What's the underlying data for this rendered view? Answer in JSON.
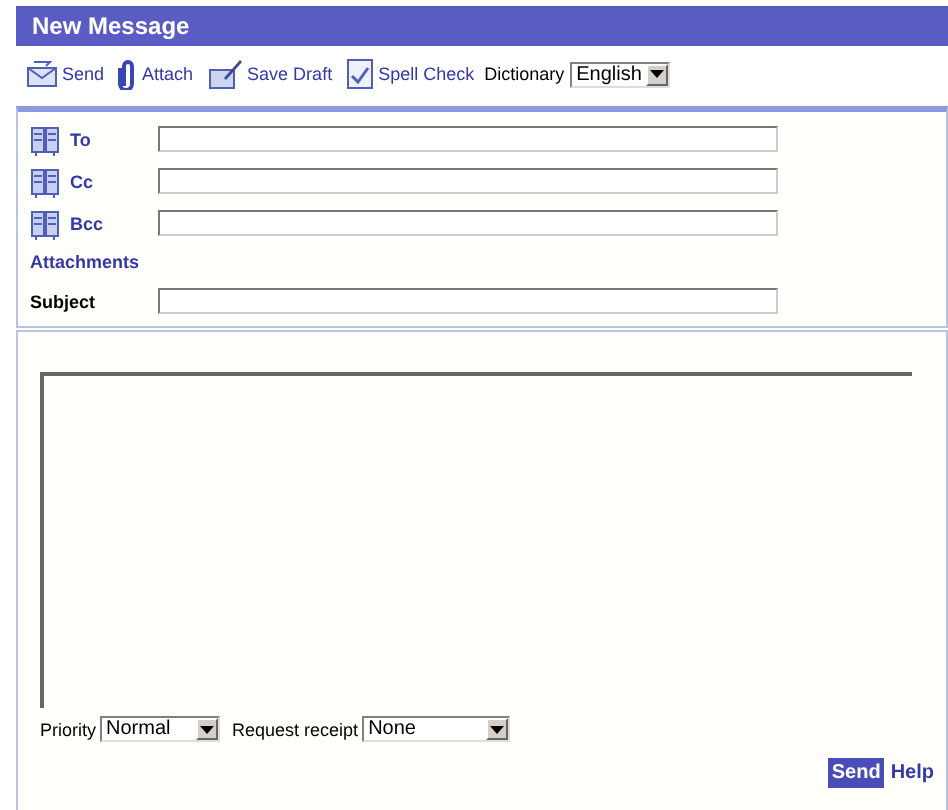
{
  "window": {
    "title": "New Message"
  },
  "toolbar": [
    {
      "kind": "send",
      "label": "Send"
    },
    {
      "kind": "attach",
      "label": "Attach"
    },
    {
      "kind": "draft",
      "label": "Save Draft"
    },
    {
      "kind": "spell",
      "label": "Spell Check"
    }
  ],
  "dictionary": {
    "label": "Dictionary",
    "value": "English"
  },
  "header_rows": [
    {
      "kind": "address",
      "label": "To"
    },
    {
      "kind": "address",
      "label": "Cc"
    },
    {
      "kind": "address",
      "label": "Bcc"
    },
    {
      "kind": "heading",
      "label": "Attachments"
    },
    {
      "kind": "field",
      "label": "Subject"
    }
  ],
  "options": [
    {
      "label": "Priority",
      "value": "Normal"
    },
    {
      "label": "Request receipt",
      "value": "None"
    }
  ],
  "actions": [
    {
      "kind": "primary",
      "label": "Send"
    },
    {
      "kind": "link",
      "label": "Help"
    }
  ]
}
